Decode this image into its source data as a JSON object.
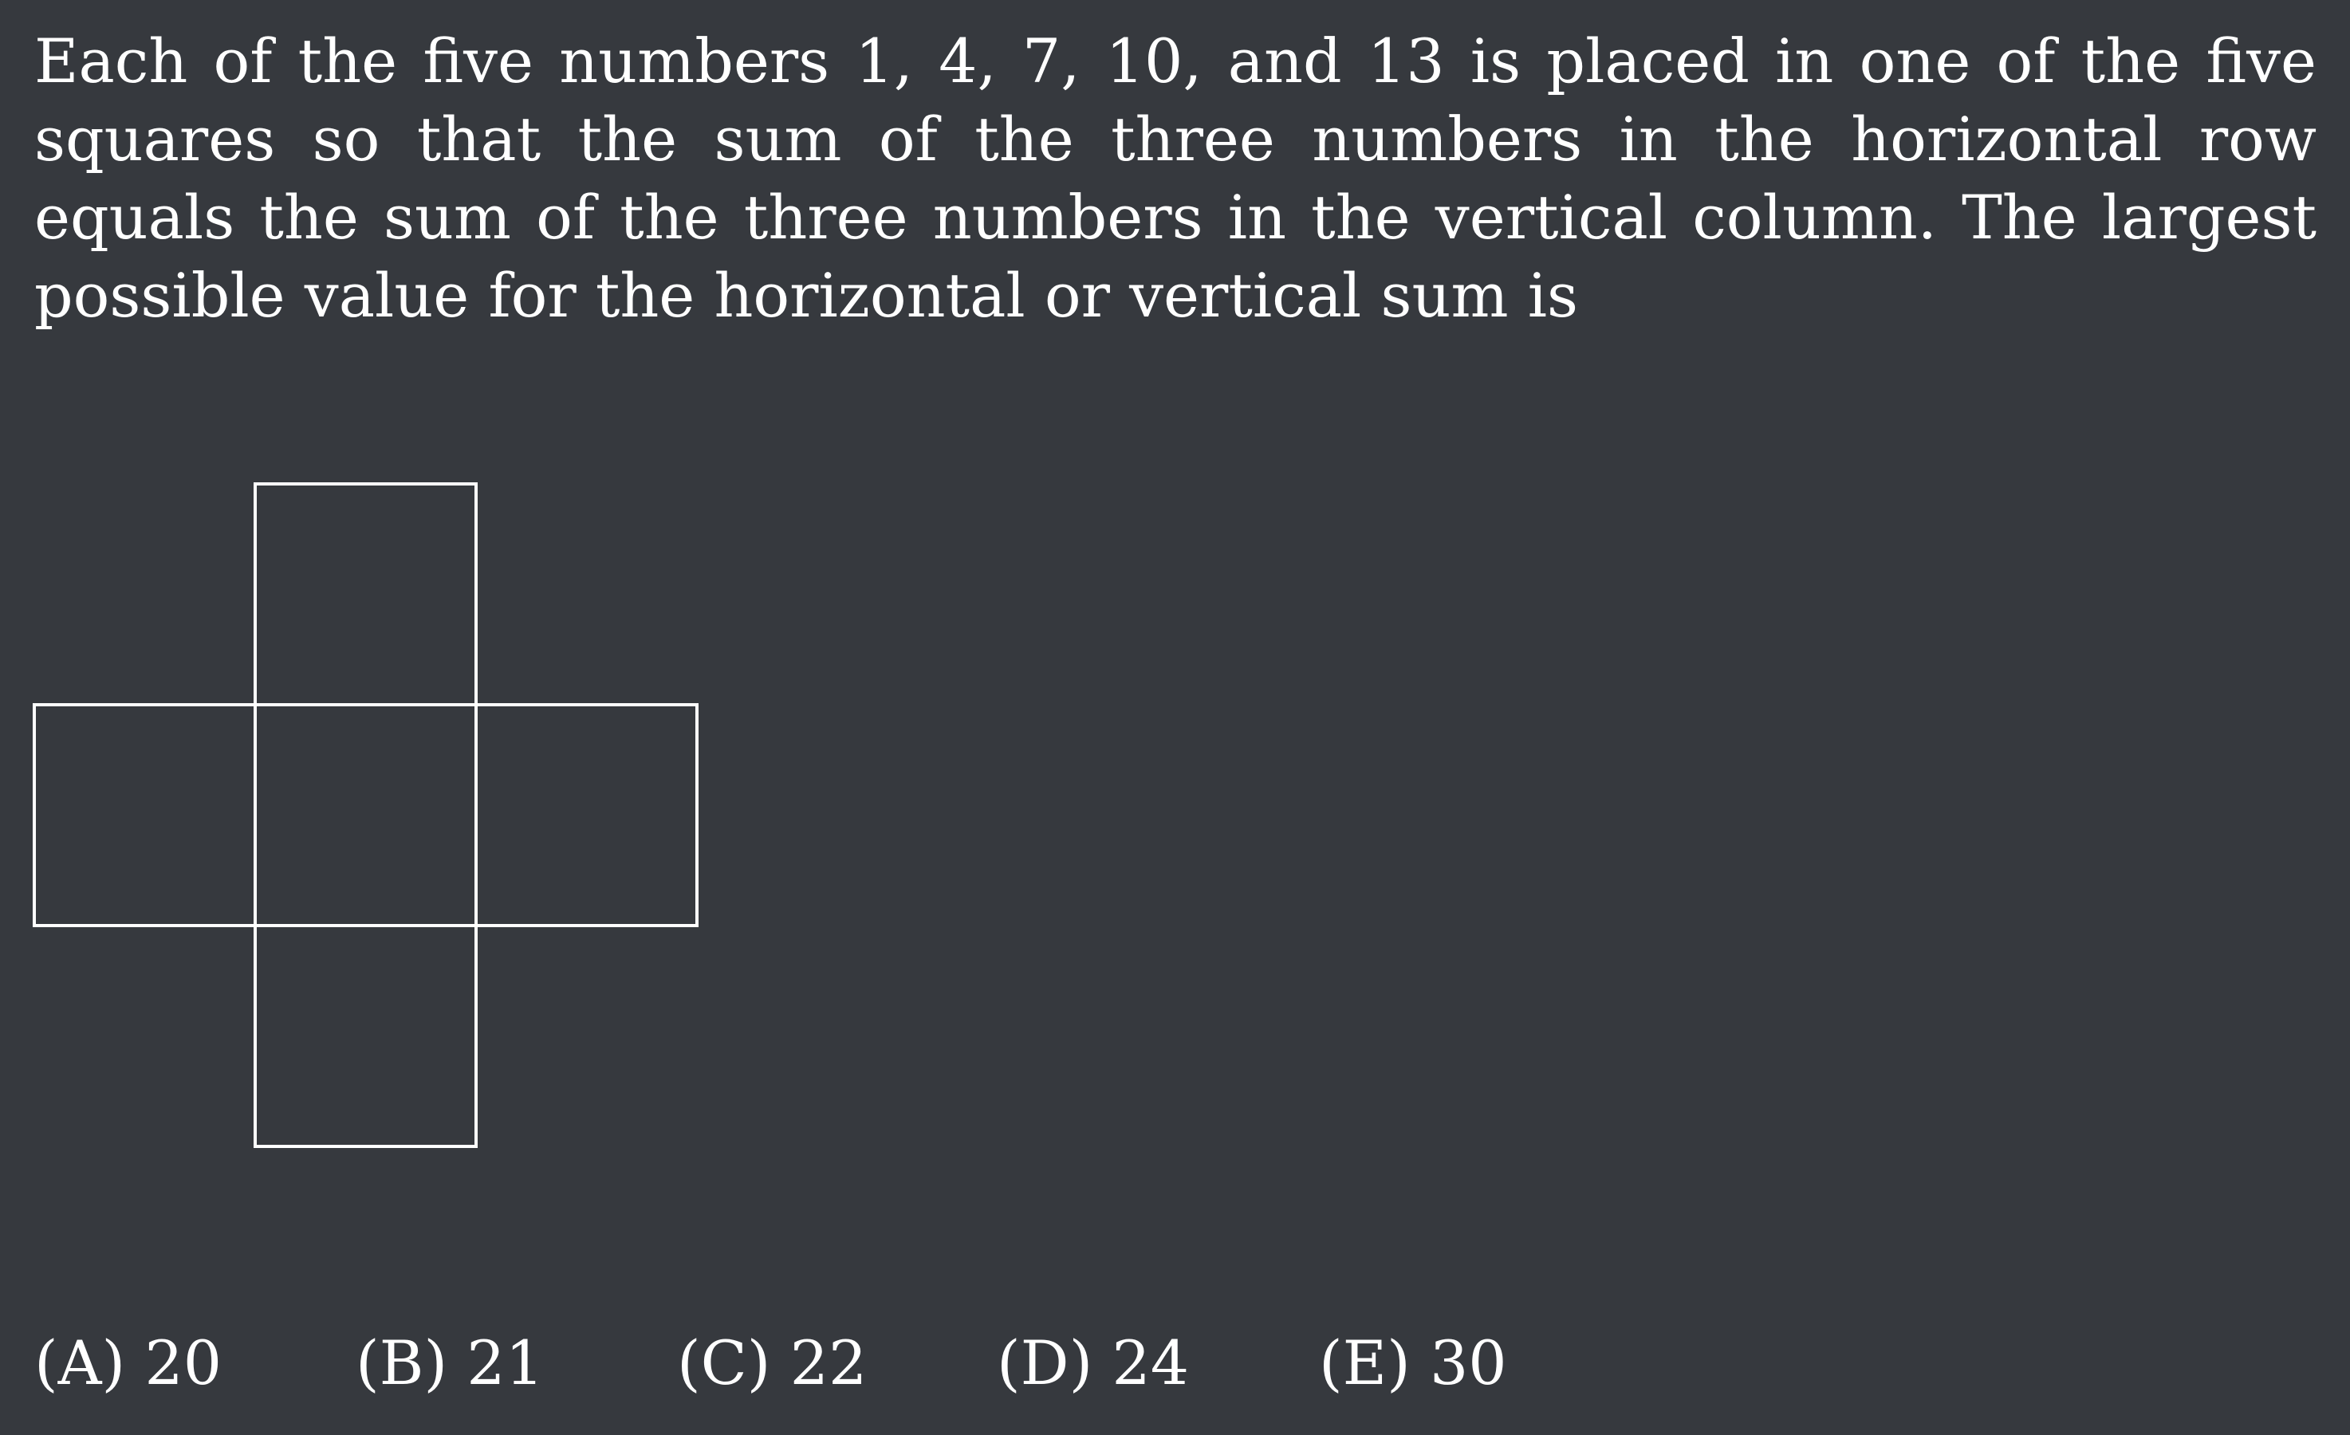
{
  "problem": {
    "text": "Each of the five numbers 1, 4, 7, 10, and 13 is placed in one of the five squares so that the sum of the three numbers in the horizontal row equals the sum of the three numbers in the vertical column.  The largest possible value for the horizontal or vertical sum is"
  },
  "answer_choices": [
    {
      "label": "(A) 20"
    },
    {
      "label": "(B) 21"
    },
    {
      "label": "(C) 22"
    },
    {
      "label": "(D) 24"
    },
    {
      "label": "(E) 30"
    }
  ],
  "colors": {
    "background": "#36393e",
    "foreground": "#ffffff"
  }
}
